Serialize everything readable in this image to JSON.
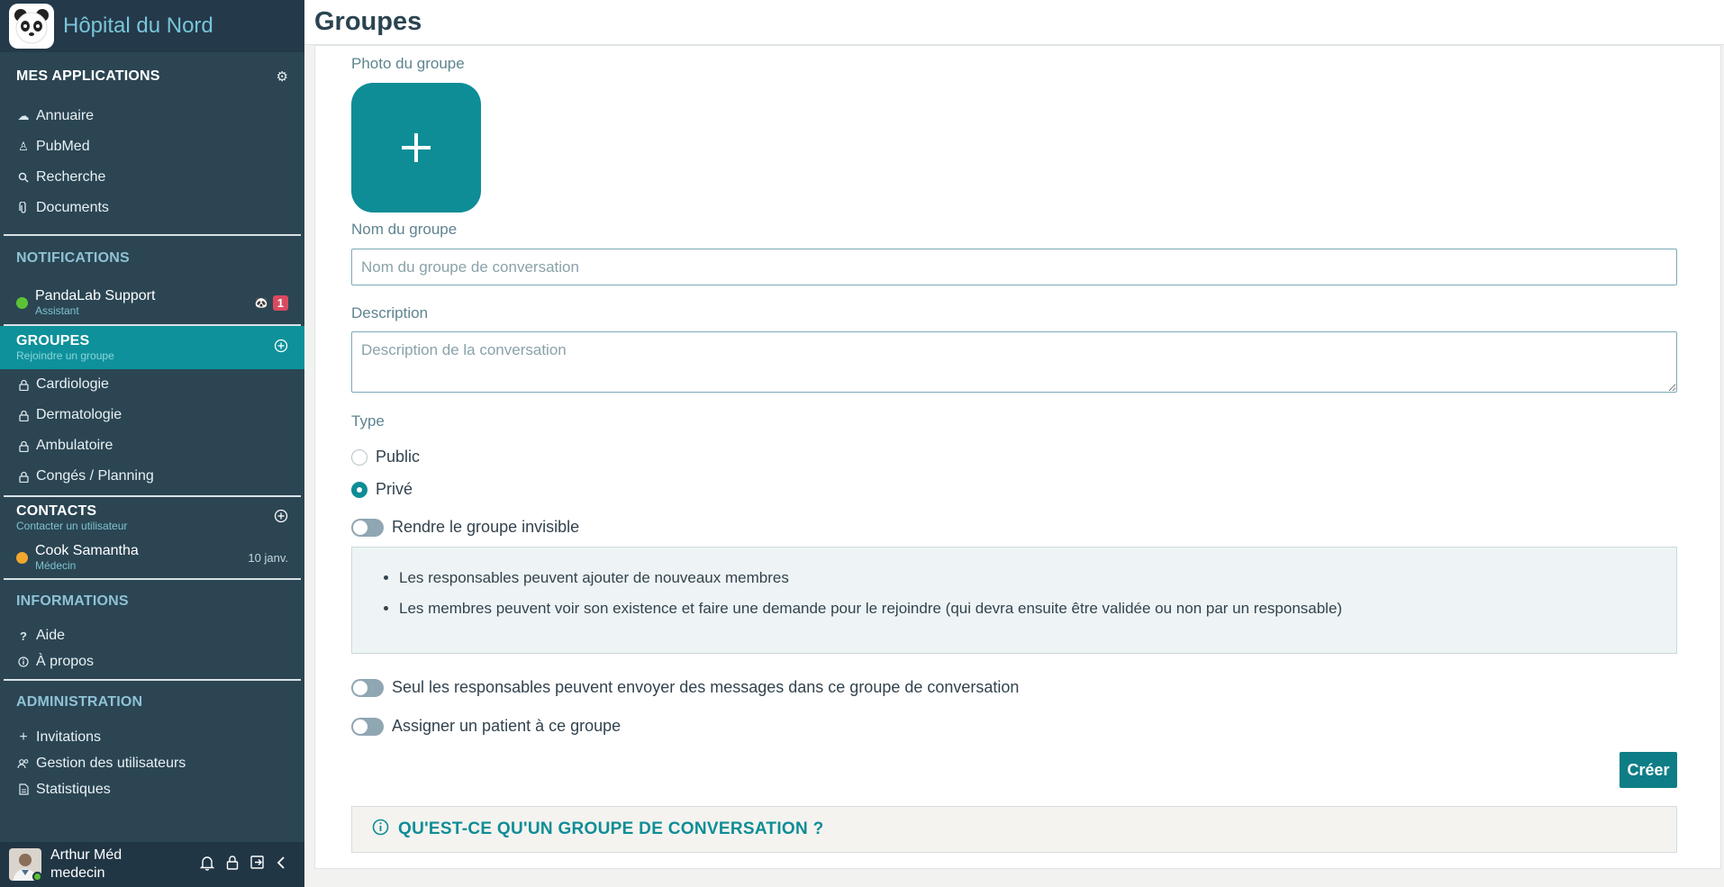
{
  "brand": {
    "title": "Hôpital du Nord"
  },
  "sidebar": {
    "apps": {
      "title": "MES APPLICATIONS",
      "items": [
        {
          "label": "Annuaire",
          "icon": "cloud-icon"
        },
        {
          "label": "PubMed",
          "icon": "person-icon"
        },
        {
          "label": "Recherche",
          "icon": "search-icon"
        },
        {
          "label": "Documents",
          "icon": "paperclip-icon"
        }
      ]
    },
    "notifications": {
      "title": "NOTIFICATIONS",
      "item": {
        "name": "PandaLab Support",
        "role": "Assistant",
        "badge": "1",
        "status_color": "#5bc236"
      }
    },
    "groupes": {
      "title": "GROUPES",
      "subtitle": "Rejoindre un groupe",
      "items": [
        {
          "label": "Cardiologie"
        },
        {
          "label": "Dermatologie"
        },
        {
          "label": "Ambulatoire"
        },
        {
          "label": "Congés / Planning"
        }
      ]
    },
    "contacts": {
      "title": "CONTACTS",
      "subtitle": "Contacter un utilisateur",
      "item": {
        "name": "Cook Samantha",
        "role": "Médecin",
        "date": "10 janv.",
        "status_color": "#f2a72e"
      }
    },
    "informations": {
      "title": "INFORMATIONS",
      "items": [
        {
          "label": "Aide",
          "icon": "question-icon"
        },
        {
          "label": "À propos",
          "icon": "info-icon"
        }
      ]
    },
    "administration": {
      "title": "ADMINISTRATION",
      "items": [
        {
          "label": "Invitations",
          "icon": "plus-icon"
        },
        {
          "label": "Gestion des utilisateurs",
          "icon": "users-icon"
        },
        {
          "label": "Statistiques",
          "icon": "document-icon"
        }
      ]
    },
    "user": {
      "name": "Arthur Méd",
      "role": "medecin"
    }
  },
  "page": {
    "title": "Groupes"
  },
  "form": {
    "photo_label": "Photo du groupe",
    "name_label": "Nom du groupe",
    "name_placeholder": "Nom du groupe de conversation",
    "name_value": "",
    "description_label": "Description",
    "description_placeholder": "Description de la conversation",
    "description_value": "",
    "type_label": "Type",
    "type_options": [
      {
        "label": "Public",
        "selected": false
      },
      {
        "label": "Privé",
        "selected": true
      }
    ],
    "invisible_toggle": {
      "label": "Rendre le groupe invisible",
      "on": false
    },
    "info_bullets": [
      "Les responsables peuvent ajouter de nouveaux membres",
      "Les membres peuvent voir son existence et faire une demande pour le rejoindre (qui devra ensuite être validée ou non par un responsable)"
    ],
    "only_admins_toggle": {
      "label": "Seul les responsables peuvent envoyer des messages dans ce groupe de conversation",
      "on": false
    },
    "assign_patient_toggle": {
      "label": "Assigner un patient à ce groupe",
      "on": false
    },
    "create_label": "Créer"
  },
  "faq": {
    "label": "QU'EST-CE QU'UN GROUPE DE CONVERSATION ?"
  },
  "colors": {
    "accent": "#0e8d96",
    "sidebar_bg": "#2b4553",
    "badge": "#d94a5e"
  }
}
